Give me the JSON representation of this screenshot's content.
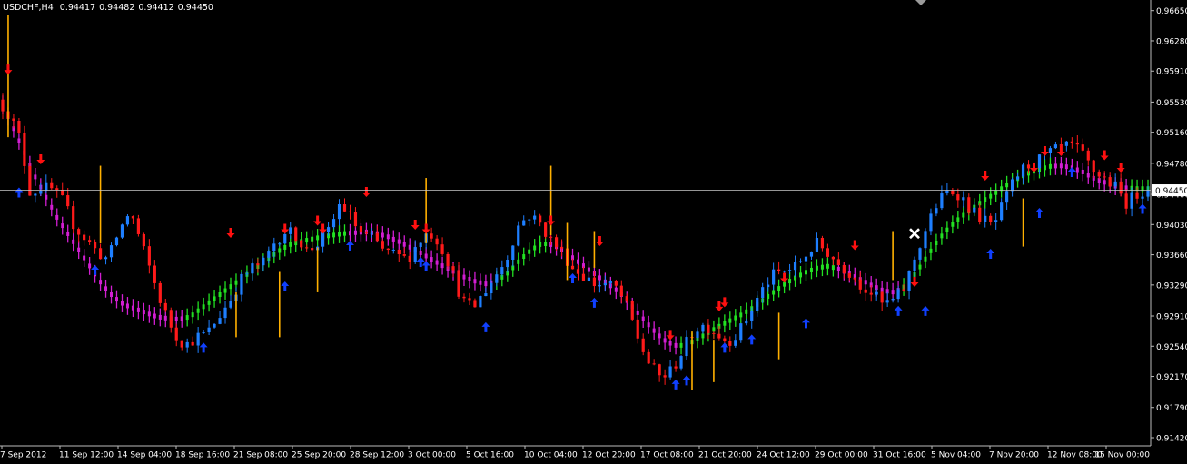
{
  "header": {
    "symbol": "USDCHF,H4",
    "open": "0.94417",
    "high": "0.94482",
    "low": "0.94412",
    "close": "0.94450"
  },
  "colors": {
    "background": "#000000",
    "bull_candle": "#1e7fff",
    "bear_candle": "#ff1a1a",
    "band_up": "#22e022",
    "band_down": "#d21ed2",
    "signal_line": "#ffb000",
    "arrow_up": "#1040ff",
    "arrow_down": "#ff1010",
    "price_line": "#c8c8c8",
    "axis_text": "#ffffff"
  },
  "chart_data": {
    "type": "candlestick",
    "title": "USDCHF,H4",
    "y_ticks": [
      "0.96650",
      "0.96280",
      "0.95910",
      "0.95530",
      "0.95160",
      "0.94780",
      "0.94400",
      "0.94030",
      "0.93660",
      "0.93290",
      "0.92910",
      "0.92540",
      "0.92170",
      "0.91790",
      "0.91420"
    ],
    "x_ticks": [
      "7 Sep 2012",
      "11 Sep 12:00",
      "14 Sep 04:00",
      "18 Sep 16:00",
      "21 Sep 08:00",
      "25 Sep 20:00",
      "28 Sep 12:00",
      "3 Oct 00:00",
      "5 Oct 16:00",
      "10 Oct 04:00",
      "12 Oct 20:00",
      "17 Oct 08:00",
      "21 Oct 20:00",
      "24 Oct 12:00",
      "29 Oct 00:00",
      "31 Oct 16:00",
      "5 Nov 04:00",
      "7 Nov 20:00",
      "12 Nov 08:00",
      "15 Nov 00:00"
    ],
    "current_price": "0.94450",
    "ylim": [
      0.9132,
      0.9678
    ],
    "grid": false,
    "price_path": [
      0.9556,
      0.954,
      0.951,
      0.944,
      0.945,
      0.9445,
      0.943,
      0.94,
      0.9385,
      0.937,
      0.936,
      0.9395,
      0.942,
      0.938,
      0.934,
      0.93,
      0.927,
      0.9255,
      0.9265,
      0.927,
      0.929,
      0.931,
      0.9335,
      0.935,
      0.9355,
      0.938,
      0.9395,
      0.939,
      0.937,
      0.938,
      0.9395,
      0.943,
      0.941,
      0.939,
      0.9385,
      0.937,
      0.9365,
      0.936,
      0.938,
      0.9395,
      0.938,
      0.935,
      0.931,
      0.93,
      0.932,
      0.934,
      0.936,
      0.94,
      0.9415,
      0.9405,
      0.9385,
      0.937,
      0.935,
      0.934,
      0.933,
      0.933,
      0.9325,
      0.93,
      0.926,
      0.923,
      0.9215,
      0.9225,
      0.925,
      0.9275,
      0.928,
      0.927,
      0.926,
      0.927,
      0.9295,
      0.932,
      0.934,
      0.9345,
      0.935,
      0.9365,
      0.938,
      0.937,
      0.9355,
      0.9345,
      0.933,
      0.932,
      0.9305,
      0.931,
      0.9325,
      0.9365,
      0.94,
      0.943,
      0.9445,
      0.944,
      0.942,
      0.941,
      0.94,
      0.943,
      0.946,
      0.9475,
      0.948,
      0.949,
      0.9495,
      0.95,
      0.949,
      0.947,
      0.946,
      0.945,
      0.943,
      0.944,
      0.945
    ],
    "band_path": [
      0.955,
      0.952,
      0.949,
      0.946,
      0.9435,
      0.941,
      0.939,
      0.937,
      0.935,
      0.933,
      0.9315,
      0.9305,
      0.93,
      0.9295,
      0.929,
      0.9288,
      0.9287,
      0.929,
      0.93,
      0.931,
      0.932,
      0.933,
      0.934,
      0.935,
      0.936,
      0.937,
      0.9378,
      0.9382,
      0.9385,
      0.9388,
      0.939,
      0.9392,
      0.9393,
      0.9394,
      0.9392,
      0.9388,
      0.9382,
      0.9375,
      0.9368,
      0.936,
      0.9352,
      0.9345,
      0.9338,
      0.9333,
      0.933,
      0.9335,
      0.9345,
      0.936,
      0.9372,
      0.938,
      0.9378,
      0.937,
      0.936,
      0.935,
      0.934,
      0.933,
      0.932,
      0.9305,
      0.929,
      0.9275,
      0.9262,
      0.9255,
      0.9255,
      0.9262,
      0.927,
      0.9278,
      0.9285,
      0.9292,
      0.93,
      0.931,
      0.932,
      0.933,
      0.9338,
      0.9345,
      0.935,
      0.9352,
      0.9348,
      0.9342,
      0.9335,
      0.9328,
      0.9322,
      0.932,
      0.9328,
      0.9345,
      0.9365,
      0.9385,
      0.94,
      0.9412,
      0.9422,
      0.9432,
      0.944,
      0.945,
      0.9458,
      0.9465,
      0.947,
      0.9474,
      0.9475,
      0.9473,
      0.9468,
      0.946,
      0.9455,
      0.945,
      0.9448,
      0.9447,
      0.9447
    ],
    "band_colors": [
      "d",
      "d",
      "d",
      "d",
      "d",
      "d",
      "d",
      "d",
      "d",
      "d",
      "d",
      "d",
      "d",
      "d",
      "d",
      "d",
      "d",
      "u",
      "u",
      "u",
      "u",
      "u",
      "u",
      "u",
      "u",
      "u",
      "u",
      "u",
      "u",
      "u",
      "u",
      "u",
      "d",
      "d",
      "d",
      "d",
      "d",
      "d",
      "d",
      "d",
      "d",
      "d",
      "d",
      "d",
      "d",
      "u",
      "u",
      "u",
      "u",
      "u",
      "d",
      "d",
      "d",
      "d",
      "d",
      "d",
      "d",
      "d",
      "d",
      "d",
      "d",
      "d",
      "u",
      "u",
      "u",
      "u",
      "u",
      "u",
      "u",
      "u",
      "u",
      "u",
      "u",
      "u",
      "u",
      "u",
      "d",
      "d",
      "d",
      "d",
      "d",
      "d",
      "u",
      "u",
      "u",
      "u",
      "u",
      "u",
      "u",
      "u",
      "u",
      "u",
      "u",
      "u",
      "u",
      "u",
      "d",
      "d",
      "d",
      "d",
      "d",
      "d",
      "d",
      "u",
      "u"
    ],
    "vertical_signals": [
      {
        "i": 1,
        "from": 0.966,
        "to": 0.951
      },
      {
        "i": 18,
        "from": 0.9475,
        "to": 0.938
      },
      {
        "i": 43,
        "from": 0.932,
        "to": 0.9265
      },
      {
        "i": 51,
        "from": 0.9345,
        "to": 0.9265
      },
      {
        "i": 58,
        "from": 0.9375,
        "to": 0.932
      },
      {
        "i": 78,
        "from": 0.946,
        "to": 0.938
      },
      {
        "i": 101,
        "from": 0.9475,
        "to": 0.939
      },
      {
        "i": 104,
        "from": 0.9405,
        "to": 0.9335
      },
      {
        "i": 109,
        "from": 0.9395,
        "to": 0.935
      },
      {
        "i": 127,
        "from": 0.9272,
        "to": 0.92
      },
      {
        "i": 131,
        "from": 0.9262,
        "to": 0.921
      },
      {
        "i": 143,
        "from": 0.9295,
        "to": 0.9238
      },
      {
        "i": 164,
        "from": 0.9395,
        "to": 0.9335
      },
      {
        "i": 188,
        "from": 0.9435,
        "to": 0.9376
      }
    ],
    "down_arrows": [
      [
        1,
        0.959
      ],
      [
        7,
        0.948
      ],
      [
        42,
        0.939
      ],
      [
        52,
        0.9395
      ],
      [
        58,
        0.9405
      ],
      [
        59,
        0.9395
      ],
      [
        67,
        0.944
      ],
      [
        76,
        0.94
      ],
      [
        78,
        0.9395
      ],
      [
        101,
        0.9405
      ],
      [
        110,
        0.938
      ],
      [
        123,
        0.9265
      ],
      [
        132,
        0.93
      ],
      [
        133,
        0.9305
      ],
      [
        144,
        0.9335
      ],
      [
        157,
        0.9375
      ],
      [
        168,
        0.933
      ],
      [
        181,
        0.946
      ],
      [
        190,
        0.947
      ],
      [
        192,
        0.949
      ],
      [
        195,
        0.949
      ],
      [
        203,
        0.9485
      ],
      [
        206,
        0.947
      ]
    ],
    "up_arrows": [
      [
        3,
        0.9445
      ],
      [
        17,
        0.935
      ],
      [
        37,
        0.9255
      ],
      [
        52,
        0.933
      ],
      [
        64,
        0.938
      ],
      [
        77,
        0.936
      ],
      [
        78,
        0.9355
      ],
      [
        89,
        0.928
      ],
      [
        105,
        0.934
      ],
      [
        109,
        0.931
      ],
      [
        124,
        0.921
      ],
      [
        126,
        0.9215
      ],
      [
        133,
        0.9255
      ],
      [
        138,
        0.9265
      ],
      [
        148,
        0.9285
      ],
      [
        165,
        0.93
      ],
      [
        170,
        0.93
      ],
      [
        182,
        0.937
      ],
      [
        191,
        0.942
      ],
      [
        197,
        0.947
      ],
      [
        210,
        0.9425
      ]
    ],
    "close_marker": {
      "i": 168,
      "price": 0.9392
    }
  }
}
